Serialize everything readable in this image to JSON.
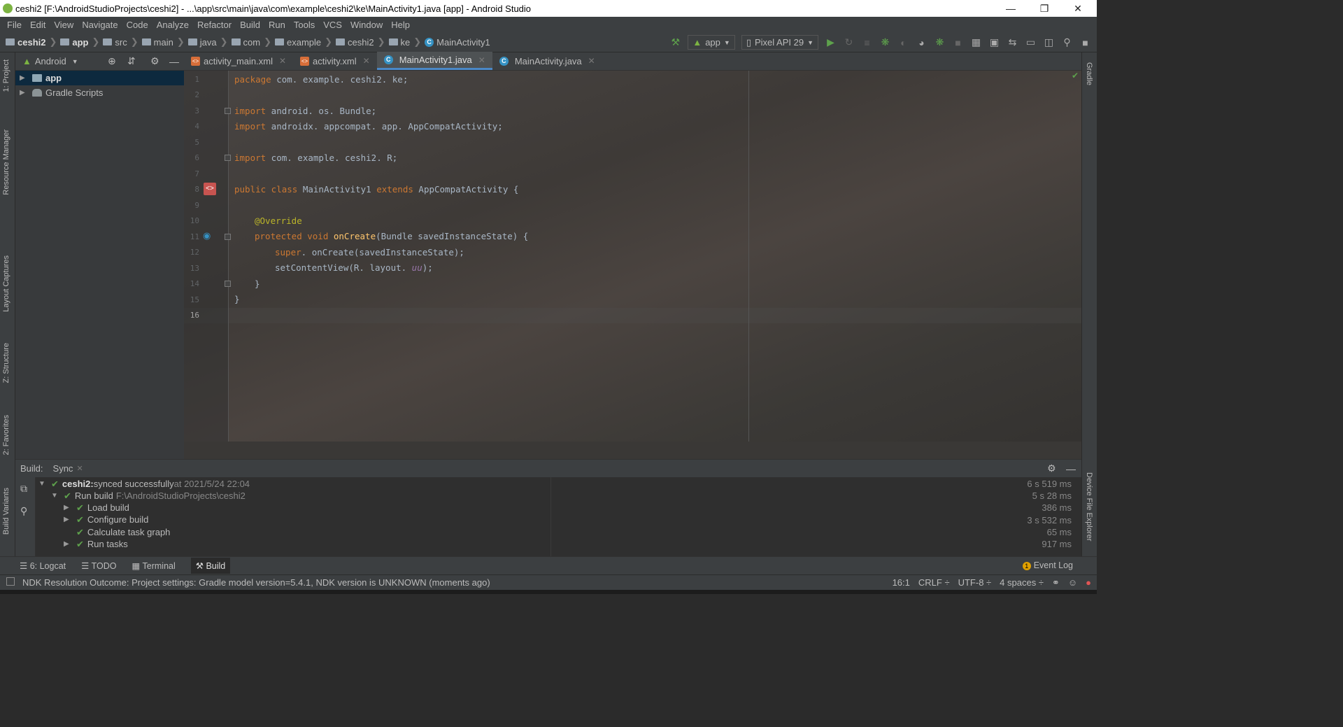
{
  "window": {
    "title": "ceshi2 [F:\\AndroidStudioProjects\\ceshi2] - ...\\app\\src\\main\\java\\com\\example\\ceshi2\\ke\\MainActivity1.java [app] - Android Studio"
  },
  "menu": [
    "File",
    "Edit",
    "View",
    "Navigate",
    "Code",
    "Analyze",
    "Refactor",
    "Build",
    "Run",
    "Tools",
    "VCS",
    "Window",
    "Help"
  ],
  "breadcrumb": [
    "ceshi2",
    "app",
    "src",
    "main",
    "java",
    "com",
    "example",
    "ceshi2",
    "ke",
    "MainActivity1"
  ],
  "toolbar": {
    "run_config": "app",
    "device": "Pixel API 29"
  },
  "project_panel": {
    "view_mode": "Android",
    "items": [
      "app",
      "Gradle Scripts"
    ]
  },
  "left_stripe": [
    "1: Project",
    "Resource Manager",
    "Layout Captures",
    "Z: Structure",
    "2: Favorites",
    "Build Variants"
  ],
  "right_stripe": [
    "Gradle",
    "Device File Explorer"
  ],
  "tabs": [
    "activity_main.xml",
    "activity.xml",
    "MainActivity1.java",
    "MainActivity.java"
  ],
  "active_tab_index": 2,
  "line_numbers": [
    "1",
    "2",
    "3",
    "4",
    "5",
    "6",
    "7",
    "8",
    "9",
    "10",
    "11",
    "12",
    "13",
    "14",
    "15",
    "16"
  ],
  "code": {
    "l1_kw": "package",
    "l1_rest": " com. example. ceshi2. ke;",
    "l3_kw": "import",
    "l3_rest": " android. os. Bundle;",
    "l4_kw": "import",
    "l4_rest": " androidx. appcompat. app. AppCompatActivity;",
    "l6_kw": "import",
    "l6_rest": " com. example. ceshi2. R;",
    "l8_kw1": "public class",
    "l8_name": " MainActivity1 ",
    "l8_kw2": "extends",
    "l8_rest": " AppCompatActivity {",
    "l10_an": "@Override",
    "l11_kw": "protected void",
    "l11_fn": " onCreate",
    "l11_rest": "(Bundle savedInstanceState) {",
    "l12_kw": "super",
    "l12_rest": ". onCreate(savedInstanceState);",
    "l13_pre": "setContentView(R. layout. ",
    "l13_it": "uu",
    "l13_post": ");",
    "l14": "}",
    "l15": "}"
  },
  "build": {
    "label": "Build:",
    "tab": "Sync",
    "root_name": "ceshi2:",
    "root_status": " synced successfully",
    "root_time": " at 2021/5/24 22:04",
    "run_build": "Run build",
    "run_build_path": "F:\\AndroidStudioProjects\\ceshi2",
    "tasks": [
      "Load build",
      "Configure build",
      "Calculate task graph",
      "Run tasks"
    ],
    "times": [
      "6 s 519 ms",
      "5 s 28 ms",
      "386 ms",
      "3 s 532 ms",
      "65 ms",
      "917 ms"
    ]
  },
  "bottom_tabs": [
    "6: Logcat",
    "TODO",
    "Terminal",
    "Build"
  ],
  "event_log": {
    "count": "1",
    "label": "Event Log"
  },
  "status": {
    "message": "NDK Resolution Outcome: Project settings: Gradle model version=5.4.1, NDK version is UNKNOWN (moments ago)",
    "position": "16:1",
    "line_sep": "CRLF ÷",
    "encoding": "UTF-8 ÷",
    "indent": "4 spaces ÷"
  }
}
